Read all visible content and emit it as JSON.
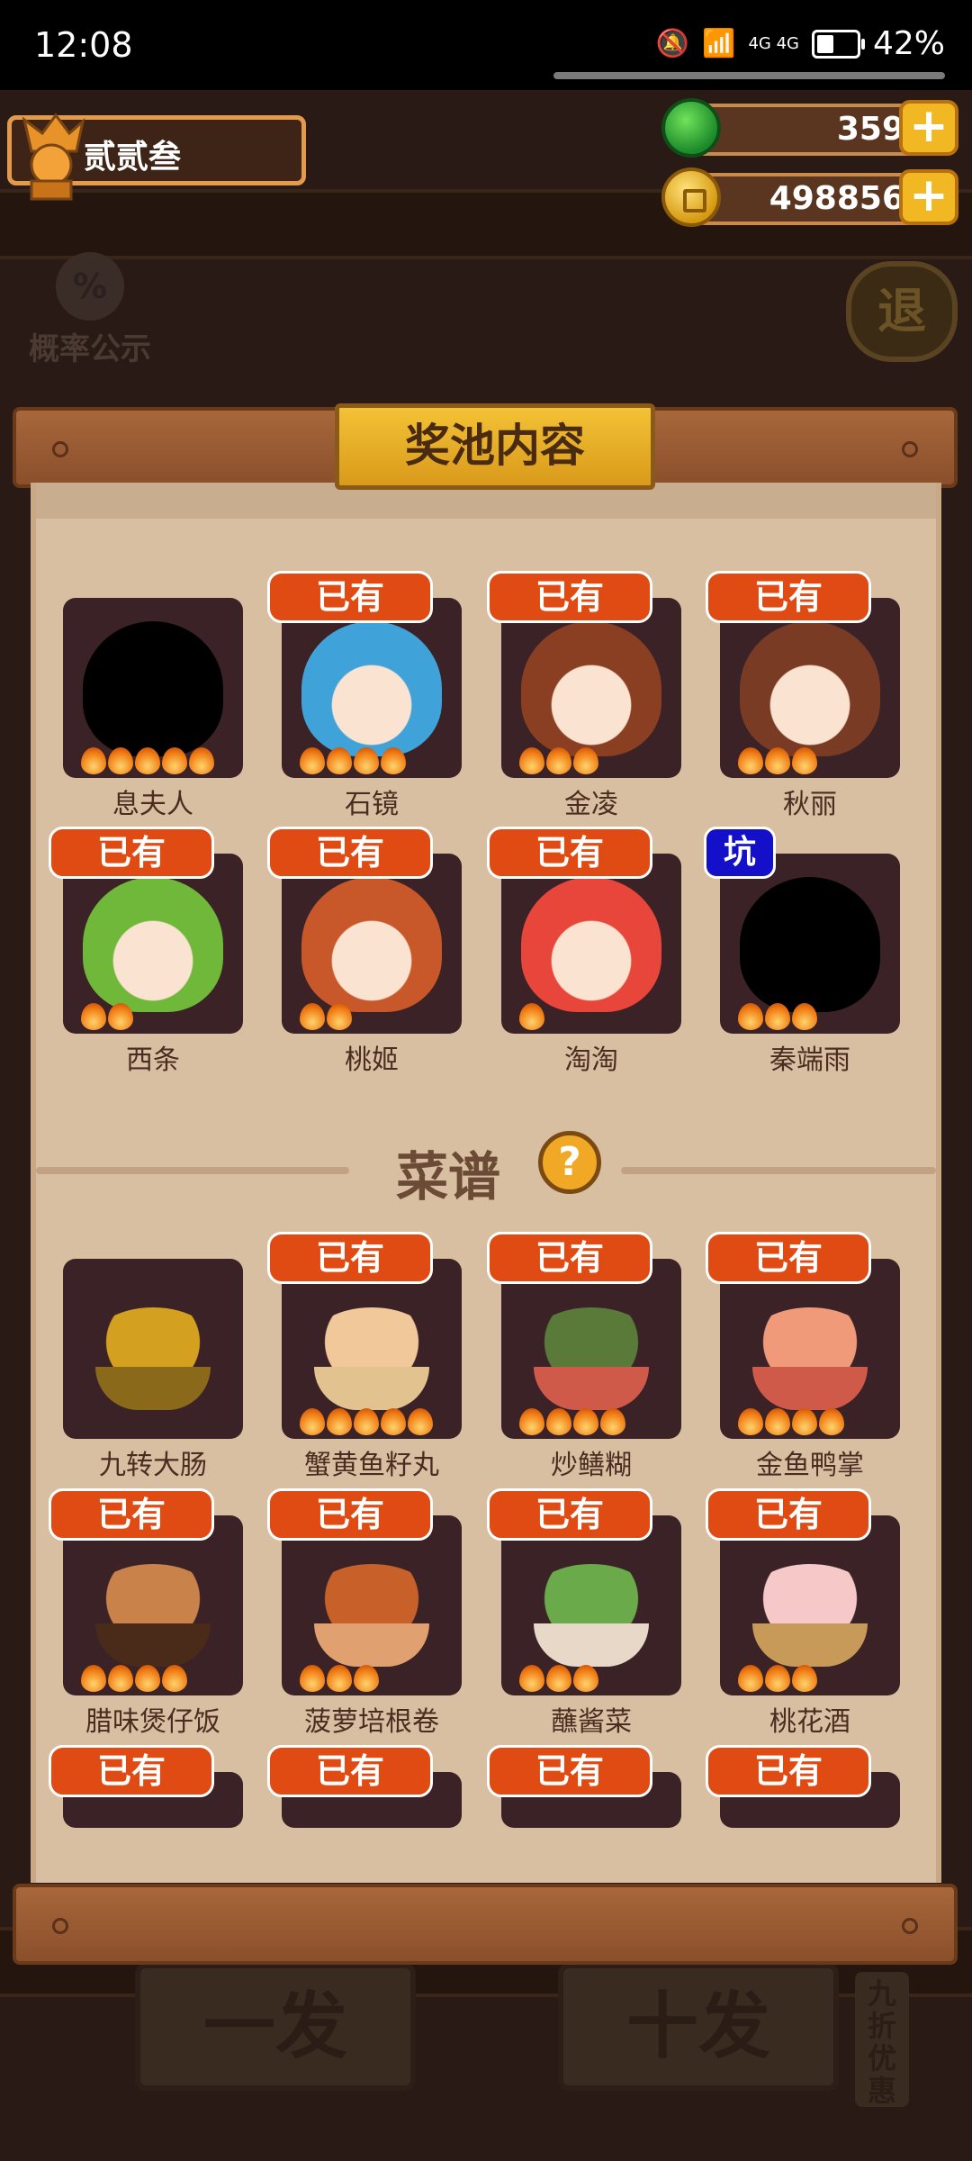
{
  "status_bar": {
    "time": "12:08",
    "network": "4G 4G",
    "battery": "42%",
    "battery_level": 0.42
  },
  "player": {
    "name": "贰贰叁"
  },
  "currency": {
    "jade": "359",
    "coins": "498856"
  },
  "background": {
    "probability_label": "概率公示",
    "probability_icon": "%",
    "back_label": "退",
    "single_draw": "一发",
    "ten_draw": "十发",
    "discount": "九折优惠"
  },
  "panel": {
    "title": "奖池内容",
    "recipes_title": "菜谱",
    "help_label": "?"
  },
  "badges": {
    "owned": "已有",
    "pit": "坑"
  },
  "characters": [
    {
      "name": "息夫人",
      "stars": 5,
      "owned": false,
      "silhouette": true,
      "hair": "#000000"
    },
    {
      "name": "石镜",
      "stars": 4,
      "owned": true,
      "silhouette": false,
      "hair": "#3fa2d8"
    },
    {
      "name": "金凌",
      "stars": 3,
      "owned": true,
      "silhouette": false,
      "hair": "#8a3f22"
    },
    {
      "name": "秋丽",
      "stars": 3,
      "owned": true,
      "silhouette": false,
      "hair": "#7a3b25"
    },
    {
      "name": "西条",
      "stars": 2,
      "owned": true,
      "silhouette": false,
      "hair": "#6fb83a"
    },
    {
      "name": "桃姬",
      "stars": 2,
      "owned": true,
      "silhouette": false,
      "hair": "#c8572a"
    },
    {
      "name": "淘淘",
      "stars": 1,
      "owned": true,
      "silhouette": false,
      "hair": "#e8463a"
    },
    {
      "name": "秦端雨",
      "stars": 3,
      "owned": false,
      "silhouette": true,
      "pit": true,
      "hair": "#000000"
    }
  ],
  "recipes": [
    {
      "name": "九转大肠",
      "stars": 0,
      "owned": false,
      "color": "#d4a020",
      "bowl": "#8a6a1a"
    },
    {
      "name": "蟹黄鱼籽丸",
      "stars": 5,
      "owned": true,
      "color": "#f0c89a",
      "bowl": "#e2c390"
    },
    {
      "name": "炒鳝糊",
      "stars": 4,
      "owned": true,
      "color": "#5a7a3a",
      "bowl": "#d05a4a"
    },
    {
      "name": "金鱼鸭掌",
      "stars": 4,
      "owned": true,
      "color": "#f09a7a",
      "bowl": "#d05a4a"
    },
    {
      "name": "腊味煲仔饭",
      "stars": 4,
      "owned": true,
      "color": "#c8824a",
      "bowl": "#4a2a18"
    },
    {
      "name": "菠萝培根卷",
      "stars": 3,
      "owned": true,
      "color": "#c8602a",
      "bowl": "#e0a070"
    },
    {
      "name": "蘸酱菜",
      "stars": 3,
      "owned": true,
      "color": "#6aaa4a",
      "bowl": "#e8d8c8"
    },
    {
      "name": "桃花酒",
      "stars": 3,
      "owned": true,
      "color": "#f6c8c8",
      "bowl": "#c89a5a"
    },
    {
      "name": "",
      "stars": 0,
      "owned": true
    },
    {
      "name": "",
      "stars": 0,
      "owned": true
    },
    {
      "name": "",
      "stars": 0,
      "owned": true
    },
    {
      "name": "",
      "stars": 0,
      "owned": true
    }
  ]
}
